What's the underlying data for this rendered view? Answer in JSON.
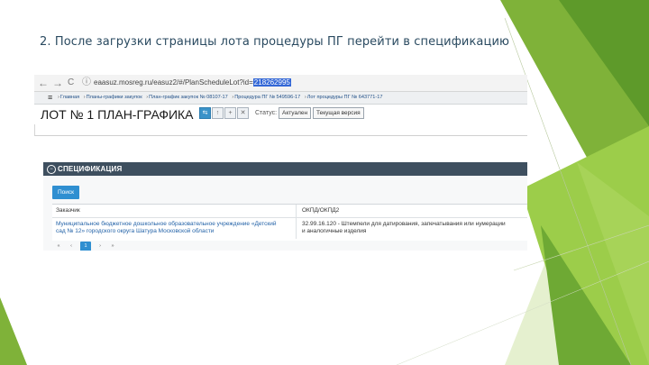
{
  "slide": {
    "title": "2. После загрузки страницы лота процедуры ПГ перейти в спецификацию"
  },
  "browser": {
    "back": "←",
    "forward": "→",
    "reload": "C",
    "info": "ⓘ",
    "url": "eaasuz.mosreg.ru/easuz2/#/PlanScheduleLot?id=",
    "url_selected": "218262995"
  },
  "breadcrumbs": [
    "Главная",
    "Планы-графики закупок",
    "План-график закупок № 08107-17",
    "Процедура ПГ № 549596-17",
    "Лот процедуры ПГ № 643771-17"
  ],
  "lot": {
    "title": "ЛОТ № 1 ПЛАН-ГРАФИКА",
    "status_label": "Статус:",
    "status_value": "Актуален",
    "version_value": "Текущая версия"
  },
  "spec": {
    "title": "СПЕЦИФИКАЦИЯ",
    "search_button": "Поиск",
    "columns": [
      "Заказчик",
      "ОКПД/ОКПД2"
    ],
    "row": {
      "customer": "Муниципальное бюджетное дошкольное образовательное учреждение «Детский сад № 12» городского округа Шатура Московской области",
      "okpd_line1": "32.99.16.120 - Штемпели для датирования, запечатывания или нумерации",
      "okpd_line2": "и аналогичные изделия"
    },
    "pager": [
      "«",
      "‹",
      "1",
      "›",
      "»"
    ]
  },
  "colors": {
    "accent_green": "#8bc53f",
    "title_color": "#2a4a60",
    "spec_header": "#3e4f5f",
    "button_blue": "#2f8fd1"
  }
}
